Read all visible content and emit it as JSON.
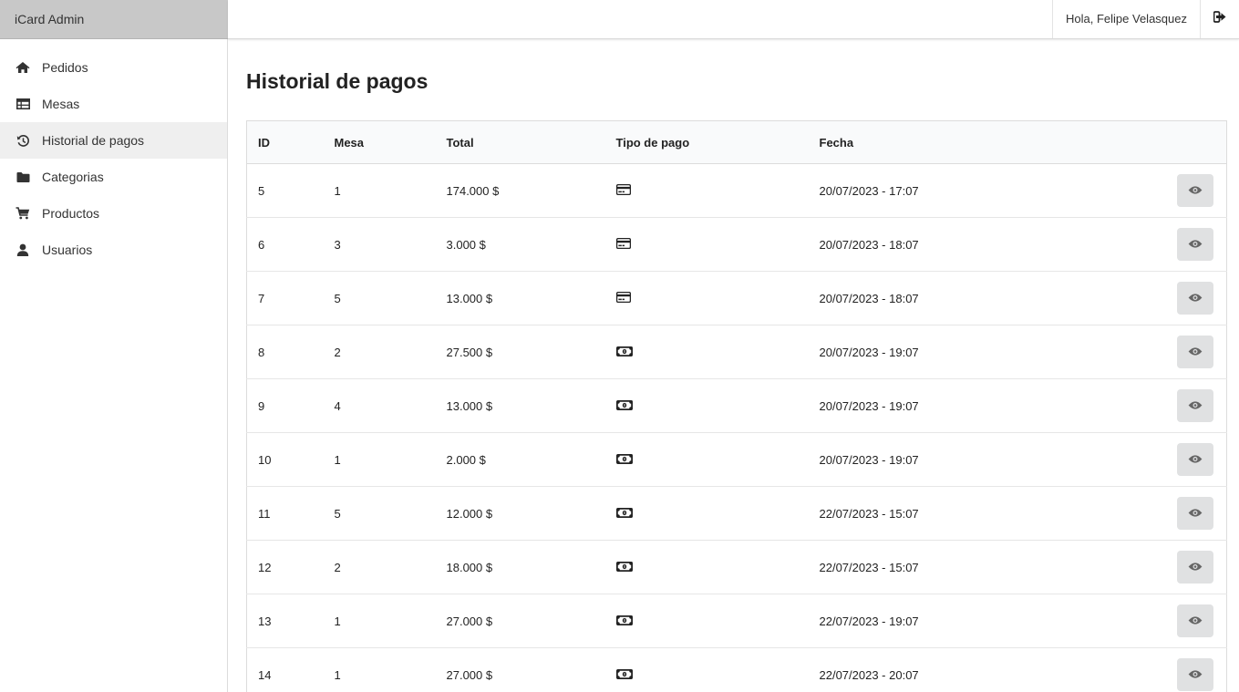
{
  "app": {
    "brand": "iCard Admin"
  },
  "header": {
    "greeting": "Hola, Felipe Velasquez",
    "logout_icon": "sign-out-icon"
  },
  "sidebar": {
    "items": [
      {
        "label": "Pedidos",
        "icon": "home-icon",
        "active": false
      },
      {
        "label": "Mesas",
        "icon": "table-icon",
        "active": false
      },
      {
        "label": "Historial de pagos",
        "icon": "history-icon",
        "active": true
      },
      {
        "label": "Categorias",
        "icon": "folder-icon",
        "active": false
      },
      {
        "label": "Productos",
        "icon": "cart-icon",
        "active": false
      },
      {
        "label": "Usuarios",
        "icon": "user-icon",
        "active": false
      }
    ]
  },
  "main": {
    "title": "Historial de pagos",
    "table": {
      "headers": [
        "ID",
        "Mesa",
        "Total",
        "Tipo de pago",
        "Fecha",
        ""
      ],
      "rows": [
        {
          "id": "5",
          "mesa": "1",
          "total": "174.000 $",
          "tipo": "card",
          "fecha": "20/07/2023 - 17:07"
        },
        {
          "id": "6",
          "mesa": "3",
          "total": "3.000 $",
          "tipo": "card",
          "fecha": "20/07/2023 - 18:07"
        },
        {
          "id": "7",
          "mesa": "5",
          "total": "13.000 $",
          "tipo": "card",
          "fecha": "20/07/2023 - 18:07"
        },
        {
          "id": "8",
          "mesa": "2",
          "total": "27.500 $",
          "tipo": "cash",
          "fecha": "20/07/2023 - 19:07"
        },
        {
          "id": "9",
          "mesa": "4",
          "total": "13.000 $",
          "tipo": "cash",
          "fecha": "20/07/2023 - 19:07"
        },
        {
          "id": "10",
          "mesa": "1",
          "total": "2.000 $",
          "tipo": "cash",
          "fecha": "20/07/2023 - 19:07"
        },
        {
          "id": "11",
          "mesa": "5",
          "total": "12.000 $",
          "tipo": "cash",
          "fecha": "22/07/2023 - 15:07"
        },
        {
          "id": "12",
          "mesa": "2",
          "total": "18.000 $",
          "tipo": "cash",
          "fecha": "22/07/2023 - 15:07"
        },
        {
          "id": "13",
          "mesa": "1",
          "total": "27.000 $",
          "tipo": "cash",
          "fecha": "22/07/2023 - 19:07"
        },
        {
          "id": "14",
          "mesa": "1",
          "total": "27.000 $",
          "tipo": "cash",
          "fecha": "22/07/2023 - 20:07"
        }
      ]
    }
  }
}
